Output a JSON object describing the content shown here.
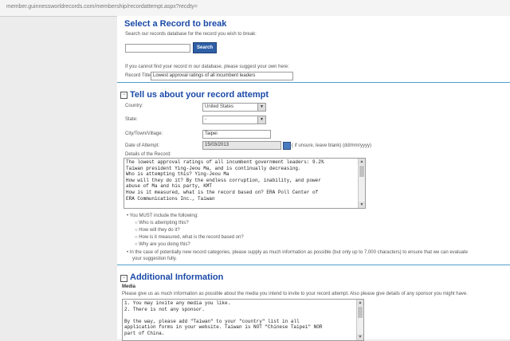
{
  "browser": {
    "url": "member.guinnessworldrecords.com/membership/recordattempt.aspx?recdty="
  },
  "select_record": {
    "title": "Select a Record to break",
    "instruction": "Search our records database for the record you wish to break:",
    "search_value": "",
    "search_button": "Search",
    "suggest_text": "If you cannot find your record in our database, please suggest your own here:",
    "record_title_label": "Record Title",
    "record_title_value": "Lowest approval ratings of all incumbent leaders"
  },
  "attempt": {
    "title": "Tell us about your record attempt",
    "icon": "collapse-icon",
    "country_label": "Country:",
    "country_value": "United States",
    "state_label": "State:",
    "state_value": "-",
    "city_label": "City/Town/Village:",
    "city_value": "Taipei",
    "date_label": "Date of Attempt:",
    "date_value": "15/03/2013",
    "date_hint": "( if unsure, leave blank) (dd/mm/yyyy)",
    "details_label": "Details of the Record:",
    "details_lines": [
      "The lowest approval ratings of all incumbent government leaders: 9.2%",
      "Taiwan president Ying-Jeou Ma, and is continually decreasing.",
      "Who is attempting this? Ying-Jeou Ma",
      "How will they do it? By the endless corruption, inability, and power",
      "abuse of Ma and his party, KMT",
      "How is it measured, what is the record based on? ERA Poll Center of",
      "ERA Communications Inc., Taiwan"
    ],
    "must_include": "You MUST include the following:",
    "sub_bullets": [
      "Who is attempting this?",
      "How will they do it?",
      "How is it measured, what is the record based on?",
      "Why are you doing this?"
    ],
    "new_category_line1": "In the case of potentially new record categories, please supply as much information as possible (but only up to 7,000 characters) to ensure that we can evaluate",
    "new_category_line2": "your suggestion fully."
  },
  "additional": {
    "title": "Additional Information",
    "icon": "collapse-icon",
    "media_label": "Media",
    "media_instruction": "Please give us as much information as possible about the media you intend to invite to your record attempt. Also please give details of any sponsor you might have.",
    "media_lines": [
      "1. You may invite any media you like.",
      "2. There is not any sponsor.",
      "",
      "By the way, please add \"Taiwan\" to your \"country\" list in all",
      "application forms in your website. Taiwan is NOT \"Chinese Taipei\" NOR",
      "part of China."
    ]
  }
}
